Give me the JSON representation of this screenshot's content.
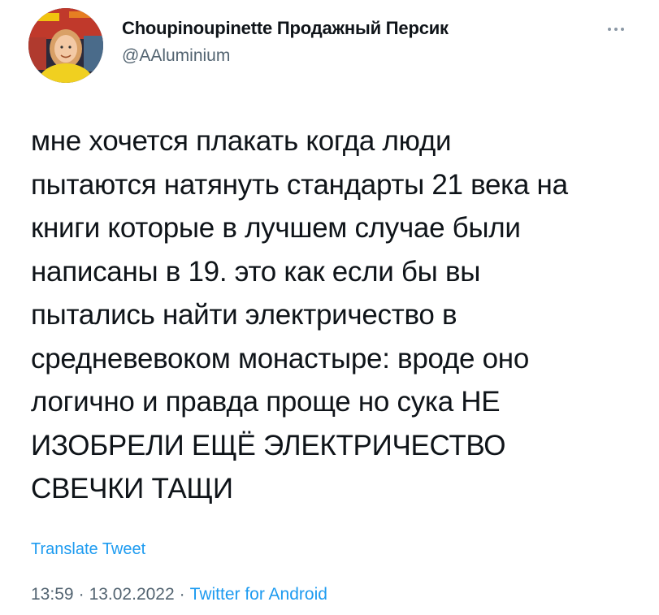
{
  "tweet": {
    "author": {
      "display_name": "Choupinoupinette Продажный Персик",
      "handle": "@AAluminium",
      "avatar_icon": "user-avatar-photo"
    },
    "more_icon": "more-dots-icon",
    "text_lines": [
      "мне хочется плакать когда люди",
      "пытаются натянуть стандарты 21 века на",
      "книги которые в лучшем случае были",
      "написаны в 19. это как если бы вы",
      "пытались найти электричество в",
      "средневевоком монастыре: вроде оно",
      "логично и правда проще но сука НЕ",
      "ИЗОБРЕЛИ ЕЩЁ ЭЛЕКТРИЧЕСТВО",
      "СВЕЧКИ ТАЩИ"
    ],
    "translate_label": "Translate Tweet",
    "meta": {
      "time": "13:59",
      "separator": "·",
      "date": "13.02.2022",
      "source": "Twitter for Android"
    }
  },
  "colors": {
    "text": "#0f1419",
    "secondary": "#536471",
    "link": "#1d9bf0"
  }
}
